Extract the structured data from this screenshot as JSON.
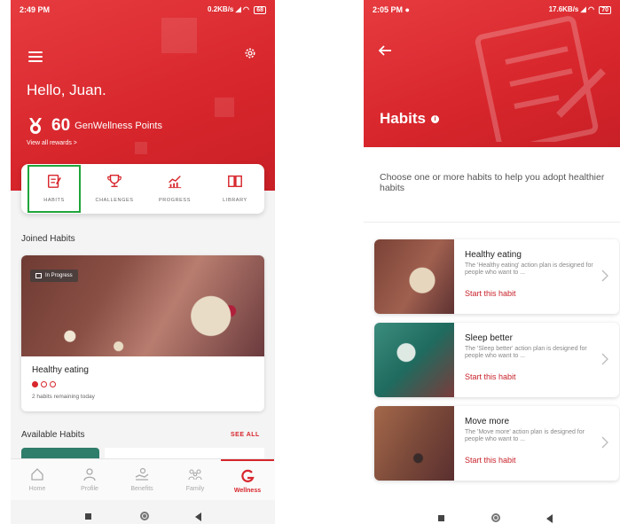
{
  "left": {
    "status": {
      "time": "2:49 PM",
      "net": "0.2KB/s",
      "battery": "68"
    },
    "greeting": "Hello, Juan.",
    "points": {
      "value": "60",
      "label": "GenWellness Points"
    },
    "view_rewards": "View all rewards >",
    "nav": [
      {
        "label": "HABITS",
        "icon": "habits-icon"
      },
      {
        "label": "CHALLENGES",
        "icon": "trophy-icon"
      },
      {
        "label": "PROGRESS",
        "icon": "chart-icon"
      },
      {
        "label": "LIBRARY",
        "icon": "book-icon"
      }
    ],
    "joined_title": "Joined Habits",
    "joined_card": {
      "chip": "In Progress",
      "title": "Healthy eating",
      "progress_dots": {
        "total": 3,
        "filled": 1
      },
      "subtitle": "2 habits remaining today"
    },
    "available_title": "Available Habits",
    "see_all": "SEE ALL",
    "bottom_nav": [
      {
        "label": "Home",
        "icon": "home-icon"
      },
      {
        "label": "Profile",
        "icon": "person-icon"
      },
      {
        "label": "Benefits",
        "icon": "benefits-icon"
      },
      {
        "label": "Family",
        "icon": "family-icon"
      },
      {
        "label": "Wellness",
        "icon": "wellness-logo-icon",
        "active": true
      }
    ]
  },
  "right": {
    "status": {
      "time": "2:05 PM",
      "net": "17.6KB/s",
      "battery": "70"
    },
    "title": "Habits",
    "intro": "Choose one or more habits to help you adopt healthier habits",
    "habits": [
      {
        "name": "Healthy eating",
        "desc": "The 'Healthy eating' action plan is designed for people who want to ...",
        "cta": "Start this habit"
      },
      {
        "name": "Sleep better",
        "desc": "The 'Sleep better' action plan is designed for people who want to ...",
        "cta": "Start this habit"
      },
      {
        "name": "Move more",
        "desc": "The 'Move more' action plan is designed for people who want to ...",
        "cta": "Start this habit"
      }
    ]
  },
  "colors": {
    "brand_red": "#d7262c",
    "highlight_green": "#1fa53a"
  }
}
